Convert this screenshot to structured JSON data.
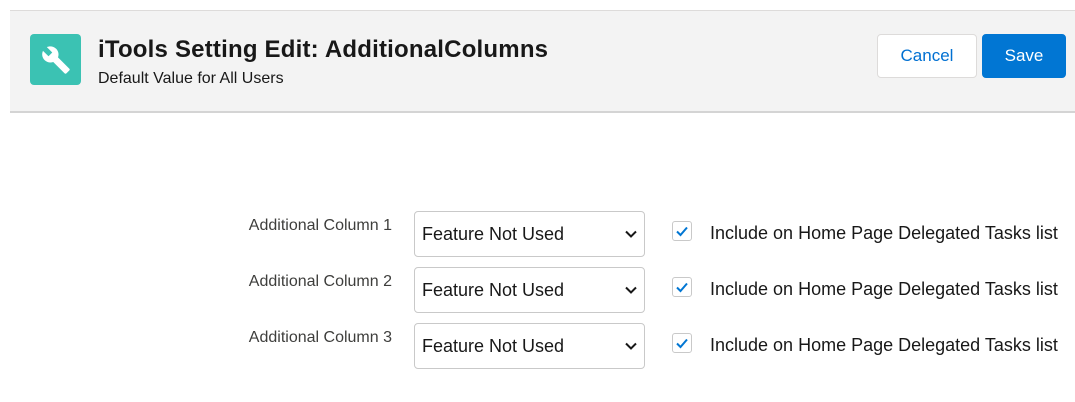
{
  "header": {
    "title": "iTools Setting Edit: AdditionalColumns",
    "subtitle": "Default Value for All Users",
    "icon": "wrench-icon",
    "icon_bg": "#3bc2b3",
    "cancel_label": "Cancel",
    "save_label": "Save",
    "accent": "#0176d3"
  },
  "rows": [
    {
      "label": "Additional Column 1",
      "select_value": "Feature Not Used",
      "checked": true,
      "checkbox_label": "Include on Home Page Delegated Tasks list"
    },
    {
      "label": "Additional Column 2",
      "select_value": "Feature Not Used",
      "checked": true,
      "checkbox_label": "Include on Home Page Delegated Tasks list"
    },
    {
      "label": "Additional Column 3",
      "select_value": "Feature Not Used",
      "checked": true,
      "checkbox_label": "Include on Home Page Delegated Tasks list"
    }
  ]
}
